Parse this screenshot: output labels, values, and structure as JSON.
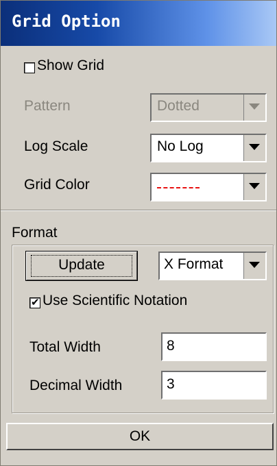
{
  "window": {
    "title": "Grid Option"
  },
  "grid": {
    "show_grid_label": "Show Grid",
    "show_grid_checked": false,
    "pattern_label": "Pattern",
    "pattern_value": "Dotted",
    "log_scale_label": "Log Scale",
    "log_scale_value": "No Log",
    "grid_color_label": "Grid Color",
    "grid_color_value": "#e81010"
  },
  "format": {
    "group_label": "Format",
    "update_label": "Update",
    "axis_format_value": "X Format",
    "scientific_notation_label": "Use Scientific Notation",
    "scientific_notation_checked": true,
    "total_width_label": "Total Width",
    "total_width_value": "8",
    "decimal_width_label": "Decimal Width",
    "decimal_width_value": "3"
  },
  "footer": {
    "ok_label": "OK"
  },
  "icons": {
    "dropdown": "chevron-down-icon",
    "checkmark": "checkmark-icon"
  }
}
